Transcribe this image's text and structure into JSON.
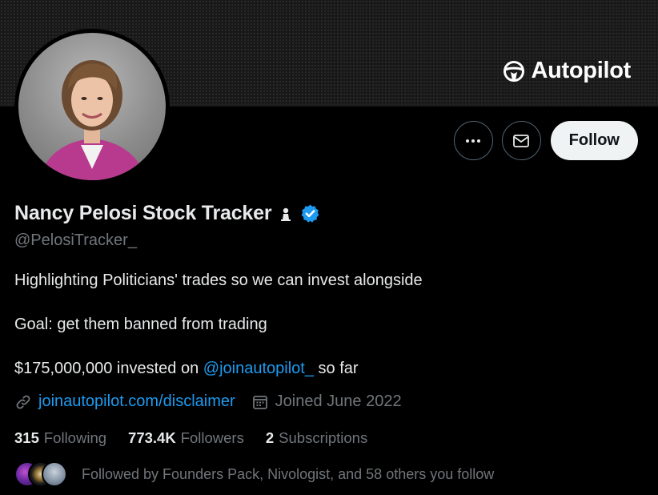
{
  "banner": {
    "brand_name": "Autopilot"
  },
  "actions": {
    "more_label": "More",
    "message_label": "Message",
    "follow_label": "Follow"
  },
  "profile": {
    "name": "Nancy Pelosi Stock Tracker",
    "handle": "@PelosiTracker_",
    "bio_line1": "Highlighting Politicians' trades so we can invest alongside",
    "bio_line2": "Goal: get them banned from trading",
    "bio_line3_prefix": "$175,000,000 invested on ",
    "bio_line3_mention": "@joinautopilot_",
    "bio_line3_suffix": " so far",
    "website": "joinautopilot.com/disclaimer",
    "joined": "Joined June 2022"
  },
  "stats": {
    "following_count": "315",
    "following_label": "Following",
    "followers_count": "773.4K",
    "followers_label": "Followers",
    "subscriptions_count": "2",
    "subscriptions_label": "Subscriptions"
  },
  "followed_by": "Followed by Founders Pack, Nivologist, and 58 others you follow",
  "colors": {
    "accent": "#1d9bf0",
    "secondary_text": "#71767b",
    "primary_text": "#e7e9ea",
    "background": "#000000"
  },
  "icons": [
    "steering-wheel-icon",
    "more-icon",
    "mail-icon",
    "affiliate-badge-icon",
    "verified-badge-icon",
    "link-icon",
    "calendar-icon"
  ]
}
